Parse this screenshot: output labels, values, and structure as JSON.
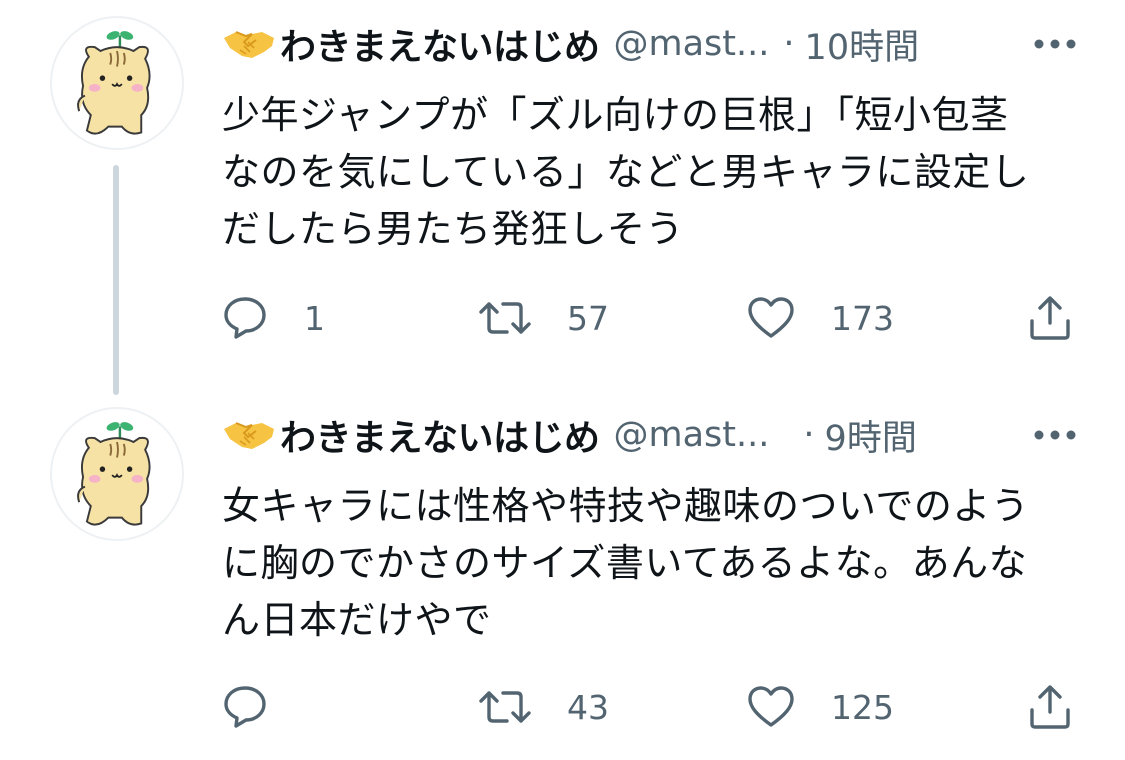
{
  "tweets": [
    {
      "avatar_icon": "hamster-avatar-icon",
      "name_emoji_icon": "handshake-icon",
      "display_name": "わきまえないはじめ",
      "handle": "@mast...",
      "separator": "·",
      "time": "10時間",
      "text_lines": [
        "少年ジャンプが「ズル向けの巨根」「短小包茎",
        "なのを気にしている」などと男キャラに設定し",
        "だしたら男たち発狂しそう"
      ],
      "reply_count": "1",
      "retweet_count": "57",
      "like_count": "173"
    },
    {
      "avatar_icon": "hamster-avatar-icon",
      "name_emoji_icon": "handshake-icon",
      "display_name": "わきまえないはじめ",
      "handle": "@mast...",
      "separator": "·",
      "time": "9時間",
      "text_lines": [
        "女キャラには性格や特技や趣味のついでのよう",
        "に胸のでかさのサイズ書いてあるよな。あんな",
        "ん日本だけやで"
      ],
      "reply_count": "",
      "retweet_count": "43",
      "like_count": "125"
    }
  ],
  "icons": {
    "reply": "reply-bubble-icon",
    "retweet": "retweet-arrows-icon",
    "like": "heart-icon",
    "share": "share-upload-icon",
    "more": "more-dots-icon"
  },
  "colors": {
    "text_primary": "#0f1419",
    "text_secondary": "#536471",
    "thread_line": "#ccd6dd",
    "avatar_fur": "#f7e2a6",
    "avatar_cheek": "#f6b3c8"
  }
}
